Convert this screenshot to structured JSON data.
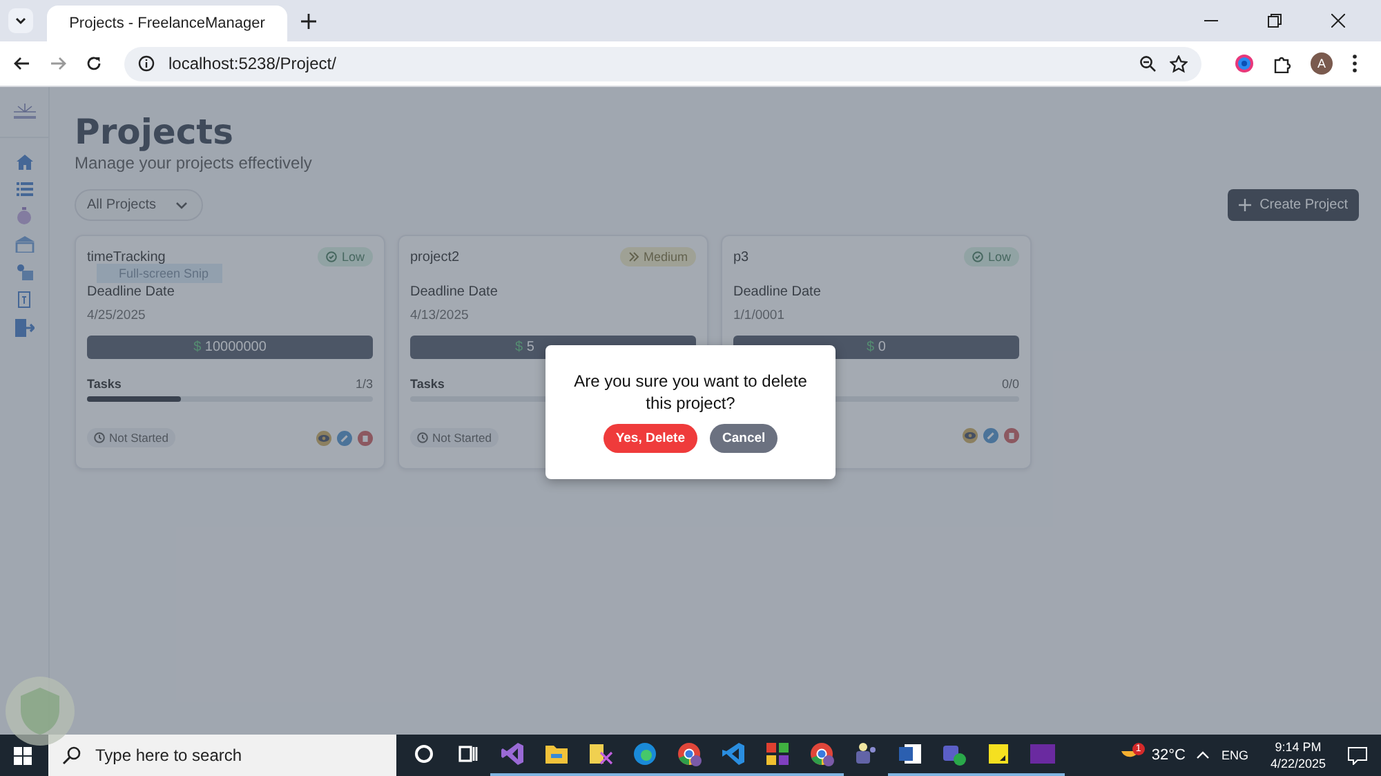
{
  "browser": {
    "tabs": [
      {
        "title": "Projects - FreelanceManager",
        "selected": true
      }
    ],
    "address": "localhost:5238/Project/",
    "profile_initial": "A"
  },
  "page": {
    "title": "Projects",
    "subtitle": "Manage your projects effectively",
    "filter": "All Projects",
    "create_button": "Create Project",
    "projects": [
      {
        "name": "timeTracking",
        "priority": {
          "kind": "low",
          "label": "Low"
        },
        "deadline_label": "Deadline Date",
        "deadline": "4/25/2025",
        "currency": "$",
        "budget": "10000000",
        "tasks_label": "Tasks",
        "tasks_count": "1/3",
        "level": 0.33,
        "status": "Not Started",
        "actions": true
      },
      {
        "name": "project2",
        "priority": {
          "kind": "medium",
          "label": "Medium"
        },
        "deadline_label": "Deadline Date",
        "deadline": "4/13/2025",
        "currency": "$",
        "budget": "5",
        "tasks_label": "Tasks",
        "level": 0,
        "status": "Not Started",
        "actions": false
      },
      {
        "name": "p3",
        "priority": {
          "kind": "low",
          "label": "Low"
        },
        "deadline_label": "Deadline Date",
        "deadline": "1/1/0001",
        "currency": "$",
        "budget": "0",
        "tasks_count": "0/0",
        "level": 0,
        "actions": true
      }
    ],
    "snip_tooltip": "Full-screen Snip"
  },
  "modal": {
    "message": "Are you sure you want to delete this project?",
    "confirm": "Yes, Delete",
    "cancel": "Cancel"
  },
  "taskbar": {
    "search_placeholder": "Type here to search",
    "apps": [
      {
        "kind": "cortana",
        "running": false
      },
      {
        "kind": "taskview",
        "running": false
      },
      {
        "kind": "visualstudio",
        "running": true
      },
      {
        "kind": "explorer",
        "running": true
      },
      {
        "kind": "snip",
        "running": true
      },
      {
        "kind": "edge",
        "running": true
      },
      {
        "kind": "chrome",
        "running": true
      },
      {
        "kind": "vscode",
        "running": true
      },
      {
        "kind": "tiles",
        "running": true
      },
      {
        "kind": "chrome",
        "running": true
      },
      {
        "kind": "teams",
        "running": false
      },
      {
        "kind": "word",
        "running": true
      },
      {
        "kind": "teams2",
        "running": true
      },
      {
        "kind": "sticky",
        "running": true
      },
      {
        "kind": "terminal",
        "running": true
      }
    ],
    "weather_badge": "1",
    "temperature": "32°C",
    "language": "ENG",
    "time": "9:14 PM",
    "date": "4/22/2025"
  }
}
